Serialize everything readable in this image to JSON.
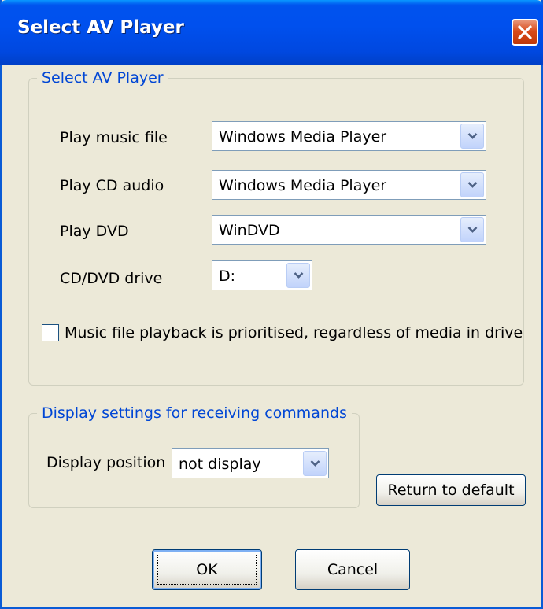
{
  "window": {
    "title": "Select AV Player"
  },
  "av_group": {
    "legend": "Select AV Player",
    "rows": [
      {
        "label": "Play music file",
        "value": "Windows Media Player"
      },
      {
        "label": "Play CD audio",
        "value": "Windows Media Player"
      },
      {
        "label": "Play DVD",
        "value": "WinDVD"
      },
      {
        "label": "CD/DVD drive",
        "value": "D:"
      }
    ],
    "checkbox_label": "Music file playback is prioritised, regardless of media in drive",
    "checkbox_checked": false
  },
  "display_group": {
    "legend": "Display settings for receiving commands",
    "position_label": "Display position",
    "position_value": "not display"
  },
  "buttons": {
    "return_default": "Return to default",
    "ok": "OK",
    "cancel": "Cancel"
  },
  "colors": {
    "titlebar": "#0050ee",
    "legend": "#0046d5",
    "background": "#ece9d8",
    "close": "#d84a1a"
  }
}
